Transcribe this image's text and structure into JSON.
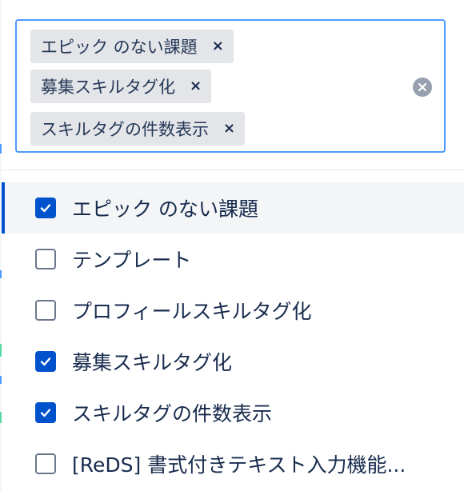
{
  "selected_tags": [
    {
      "label": "エピック のない課題"
    },
    {
      "label": "募集スキルタグ化"
    },
    {
      "label": "スキルタグの件数表示"
    }
  ],
  "tag_remove_glyph": "×",
  "options": [
    {
      "label": "エピック のない課題",
      "checked": true,
      "highlighted": true
    },
    {
      "label": "テンプレート",
      "checked": false,
      "highlighted": false
    },
    {
      "label": "プロフィールスキルタグ化",
      "checked": false,
      "highlighted": false
    },
    {
      "label": "募集スキルタグ化",
      "checked": true,
      "highlighted": false
    },
    {
      "label": "スキルタグの件数表示",
      "checked": true,
      "highlighted": false
    },
    {
      "label": "[ReDS] 書式付きテキスト入力機能...",
      "checked": false,
      "highlighted": false
    }
  ],
  "colors": {
    "focus_border": "#4c9aff",
    "checked": "#0052cc",
    "tag_bg": "#e4e5e9",
    "clear_icon": "#97a0af"
  },
  "icons": {
    "tag_remove": "close-icon",
    "clear_all": "clear-circle-icon",
    "checked_mark": "checkmark-icon"
  }
}
